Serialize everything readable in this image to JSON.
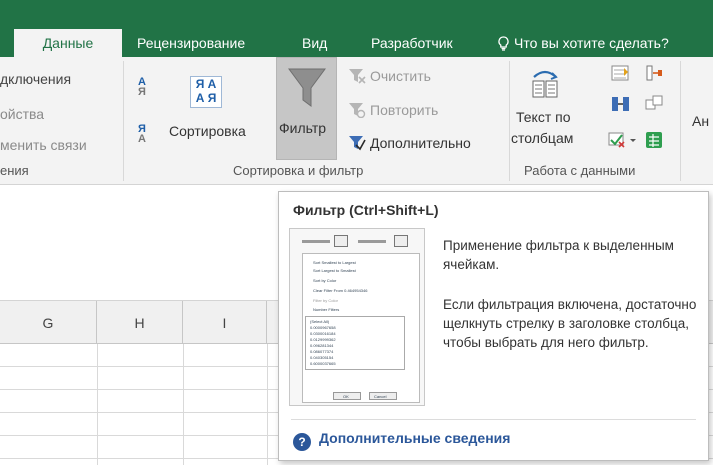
{
  "tabs": {
    "data": "Данные",
    "review": "Рецензирование",
    "view": "Вид",
    "developer": "Разработчик",
    "tell_me": "Что вы хотите сделать?"
  },
  "ribbon": {
    "connections": {
      "items": [
        "дключения",
        "ойства",
        "менить связи"
      ],
      "label": "ения"
    },
    "sort_filter": {
      "sort_az": "А Я",
      "sort_za": "Я А",
      "sort": "Сортировка",
      "filter": "Фильтр",
      "clear": "Очистить",
      "reapply": "Повторить",
      "advanced": "Дополнительно",
      "label": "Сортировка и фильтр"
    },
    "data_tools": {
      "text_to_columns_1": "Текст по",
      "text_to_columns_2": "столбцам",
      "label": "Работа с данными"
    },
    "analysis_partial": "Ан"
  },
  "columns": [
    "G",
    "H",
    "I"
  ],
  "tooltip": {
    "title": "Фильтр (Ctrl+Shift+L)",
    "p1": "Применение фильтра к выделенным ячейкам.",
    "p2": "Если фильтрация включена, достаточно щелкнуть стрелку в заголовке столбца, чтобы выбрать для него фильтр.",
    "more": "Дополнительные сведения",
    "thumbnail": {
      "menu_items": [
        "Sort Smallest to Largest",
        "Sort Largest to Smallest",
        "Sort by Color",
        "Clear Filter From 0.464954346",
        "Filter by Color",
        "Number Filters"
      ],
      "list_items": [
        "(Select All)",
        "0.0000967658",
        "0.0300016184",
        "0.0129999362",
        "0.096281344",
        "0.086077374",
        "0.040305154",
        "0.6000037665",
        "0.941365008"
      ],
      "ok": "OK",
      "cancel": "Cancel"
    }
  },
  "colors": {
    "tabbar": "#217346",
    "ribbon": "#f3f3f3",
    "accent": "#2b579a"
  }
}
